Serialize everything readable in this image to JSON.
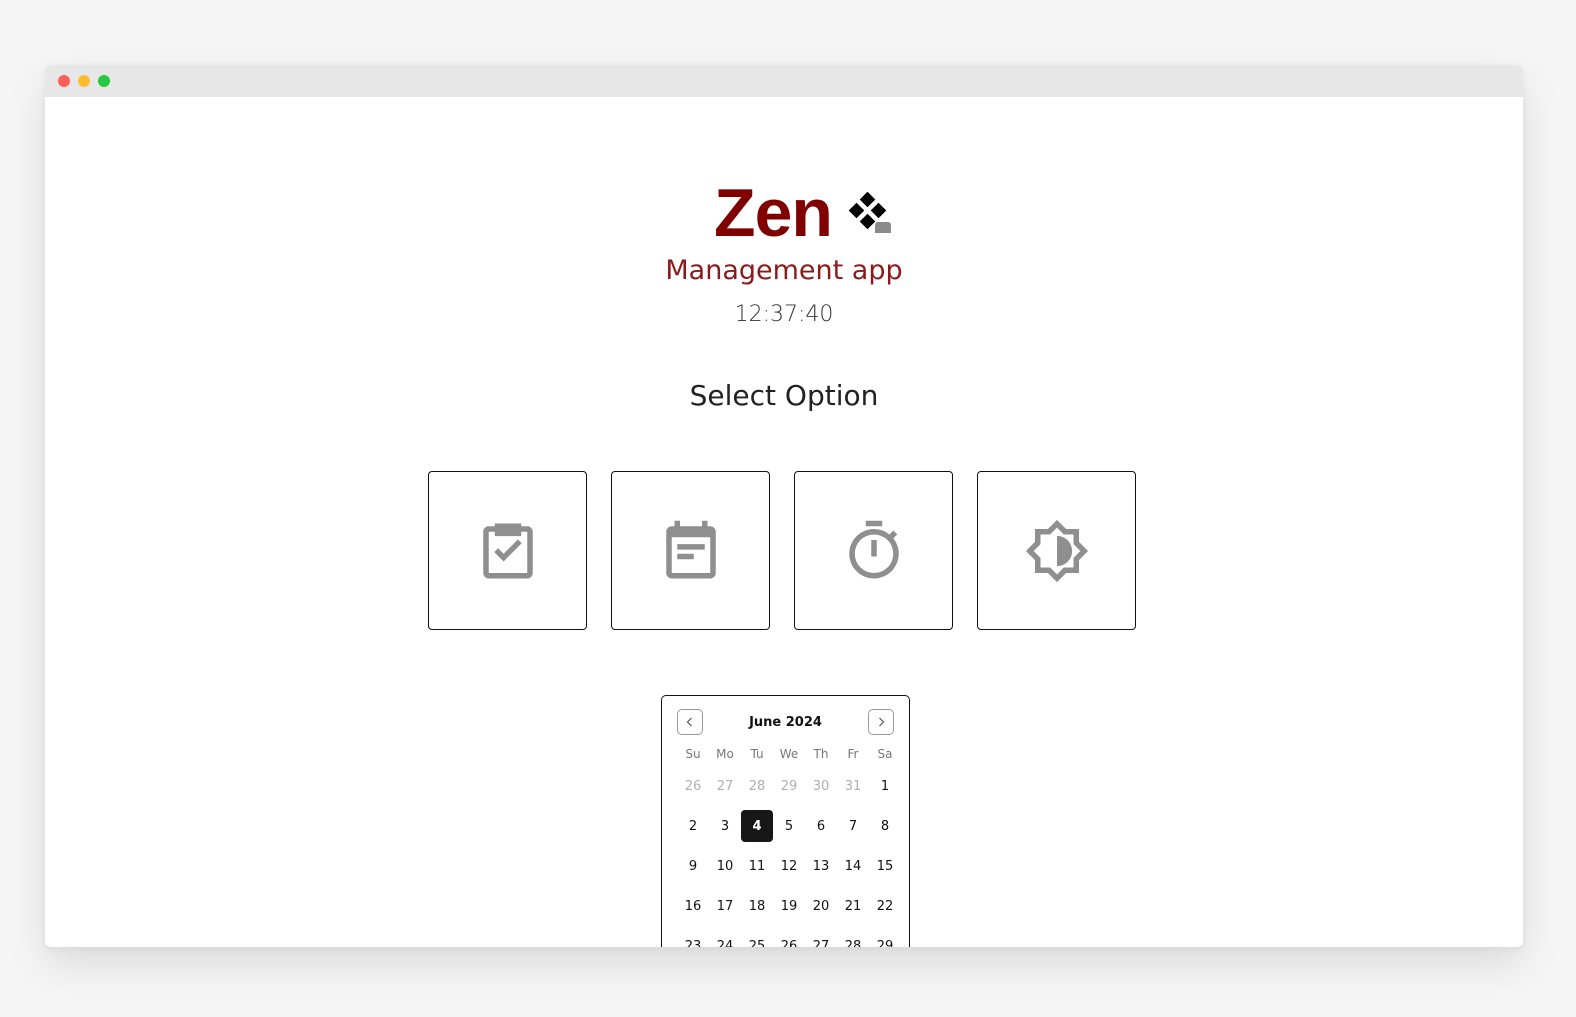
{
  "window": {
    "controls": [
      {
        "name": "close",
        "color": "#ff5f57"
      },
      {
        "name": "minimize",
        "color": "#febc2e"
      },
      {
        "name": "maximize",
        "color": "#28c840"
      }
    ]
  },
  "brand": {
    "name": "Zen",
    "name_color": "#800000",
    "logo_icon": "diamond-tiles-icon",
    "tagline": "Management app",
    "tagline_color": "#8b1a1a"
  },
  "clock": {
    "time": "12:37:40"
  },
  "options_section": {
    "title": "Select Option",
    "options": [
      {
        "icon": "clipboard-check-icon"
      },
      {
        "icon": "calendar-note-icon"
      },
      {
        "icon": "stopwatch-icon"
      },
      {
        "icon": "brightness-icon"
      }
    ],
    "icon_color": "#8f8f8f"
  },
  "calendar": {
    "month_label": "June 2024",
    "weekdays": [
      "Su",
      "Mo",
      "Tu",
      "We",
      "Th",
      "Fr",
      "Sa"
    ],
    "weeks": [
      [
        {
          "d": "26",
          "out": true
        },
        {
          "d": "27",
          "out": true
        },
        {
          "d": "28",
          "out": true
        },
        {
          "d": "29",
          "out": true
        },
        {
          "d": "30",
          "out": true
        },
        {
          "d": "31",
          "out": true
        },
        {
          "d": "1"
        }
      ],
      [
        {
          "d": "2"
        },
        {
          "d": "3"
        },
        {
          "d": "4",
          "selected": true
        },
        {
          "d": "5"
        },
        {
          "d": "6"
        },
        {
          "d": "7"
        },
        {
          "d": "8"
        }
      ],
      [
        {
          "d": "9"
        },
        {
          "d": "10"
        },
        {
          "d": "11"
        },
        {
          "d": "12"
        },
        {
          "d": "13"
        },
        {
          "d": "14"
        },
        {
          "d": "15"
        }
      ],
      [
        {
          "d": "16"
        },
        {
          "d": "17"
        },
        {
          "d": "18"
        },
        {
          "d": "19"
        },
        {
          "d": "20"
        },
        {
          "d": "21"
        },
        {
          "d": "22"
        }
      ],
      [
        {
          "d": "23"
        },
        {
          "d": "24"
        },
        {
          "d": "25"
        },
        {
          "d": "26"
        },
        {
          "d": "27"
        },
        {
          "d": "28"
        },
        {
          "d": "29"
        }
      ]
    ],
    "prev_icon": "chevron-left-icon",
    "next_icon": "chevron-right-icon"
  }
}
